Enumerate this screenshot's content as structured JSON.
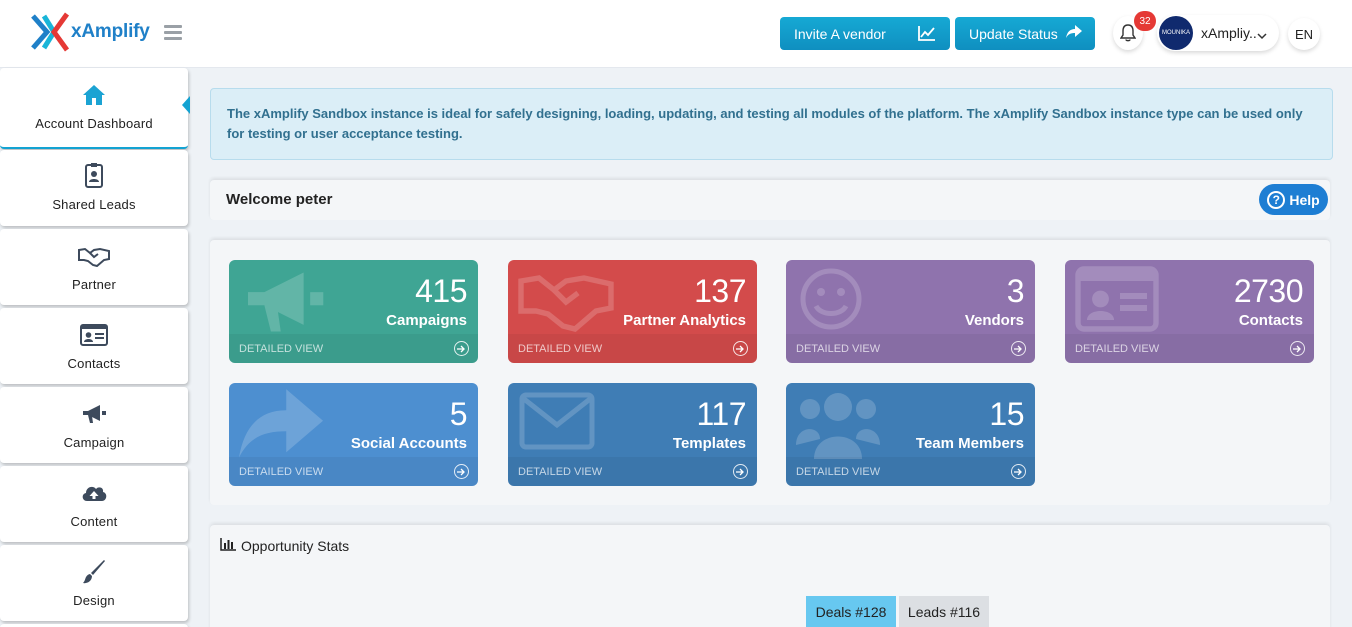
{
  "header": {
    "logo_text": "xAmplify",
    "invite_label": "Invite A vendor",
    "update_label": "Update Status",
    "notification_count": "32",
    "user_name": "xAmpliy..",
    "avatar_text": "MOUNIKA",
    "lang": "EN"
  },
  "sidebar": {
    "items": [
      {
        "label": "Account Dashboard",
        "icon": "home-icon"
      },
      {
        "label": "Shared Leads",
        "icon": "id-badge-icon"
      },
      {
        "label": "Partner",
        "icon": "handshake-icon"
      },
      {
        "label": "Contacts",
        "icon": "address-card-icon"
      },
      {
        "label": "Campaign",
        "icon": "megaphone-icon"
      },
      {
        "label": "Content",
        "icon": "cloud-upload-icon"
      },
      {
        "label": "Design",
        "icon": "paintbrush-icon"
      }
    ]
  },
  "notice": "The xAmplify Sandbox instance is ideal for safely designing, loading, updating, and testing all modules of the platform. The xAmplify Sandbox instance type can be used only for testing or user acceptance testing.",
  "welcome": "Welcome peter",
  "help_label": "Help",
  "tiles": [
    {
      "value": "415",
      "label": "Campaigns",
      "link": "DETAILED VIEW",
      "color": "#3fa594",
      "icon": "megaphone-icon"
    },
    {
      "value": "137",
      "label": "Partner Analytics",
      "link": "DETAILED VIEW",
      "color": "#d34b4b",
      "icon": "handshake-icon"
    },
    {
      "value": "3",
      "label": "Vendors",
      "link": "DETAILED VIEW",
      "color": "#8f73ad",
      "icon": "smile-icon"
    },
    {
      "value": "2730",
      "label": "Contacts",
      "link": "DETAILED VIEW",
      "color": "#8f73ad",
      "icon": "address-card-icon"
    },
    {
      "value": "5",
      "label": "Social Accounts",
      "link": "DETAILED VIEW",
      "color": "#4d8fd0",
      "icon": "share-icon"
    },
    {
      "value": "117",
      "label": "Templates",
      "link": "DETAILED VIEW",
      "color": "#3f7db5",
      "icon": "envelope-icon"
    },
    {
      "value": "15",
      "label": "Team Members",
      "link": "DETAILED VIEW",
      "color": "#3f7db5",
      "icon": "users-icon"
    }
  ],
  "stats": {
    "title": "Opportunity Stats",
    "deals_label": "Deals #128",
    "leads_label": "Leads #116"
  }
}
